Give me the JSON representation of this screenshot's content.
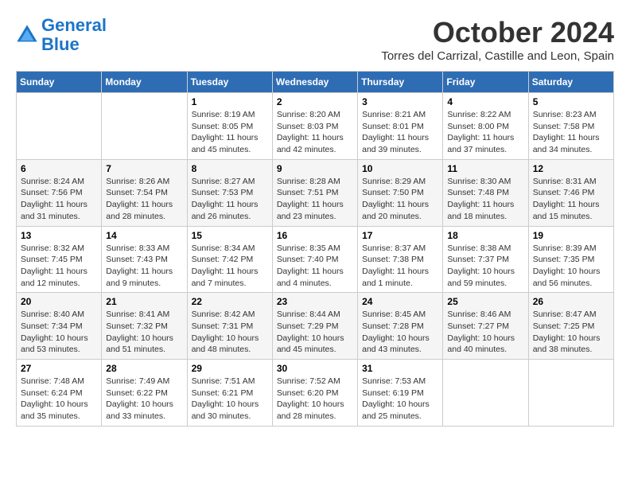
{
  "header": {
    "logo_line1": "General",
    "logo_line2": "Blue",
    "month": "October 2024",
    "location": "Torres del Carrizal, Castille and Leon, Spain"
  },
  "weekdays": [
    "Sunday",
    "Monday",
    "Tuesday",
    "Wednesday",
    "Thursday",
    "Friday",
    "Saturday"
  ],
  "weeks": [
    [
      {
        "day": "",
        "info": ""
      },
      {
        "day": "",
        "info": ""
      },
      {
        "day": "1",
        "info": "Sunrise: 8:19 AM\nSunset: 8:05 PM\nDaylight: 11 hours and 45 minutes."
      },
      {
        "day": "2",
        "info": "Sunrise: 8:20 AM\nSunset: 8:03 PM\nDaylight: 11 hours and 42 minutes."
      },
      {
        "day": "3",
        "info": "Sunrise: 8:21 AM\nSunset: 8:01 PM\nDaylight: 11 hours and 39 minutes."
      },
      {
        "day": "4",
        "info": "Sunrise: 8:22 AM\nSunset: 8:00 PM\nDaylight: 11 hours and 37 minutes."
      },
      {
        "day": "5",
        "info": "Sunrise: 8:23 AM\nSunset: 7:58 PM\nDaylight: 11 hours and 34 minutes."
      }
    ],
    [
      {
        "day": "6",
        "info": "Sunrise: 8:24 AM\nSunset: 7:56 PM\nDaylight: 11 hours and 31 minutes."
      },
      {
        "day": "7",
        "info": "Sunrise: 8:26 AM\nSunset: 7:54 PM\nDaylight: 11 hours and 28 minutes."
      },
      {
        "day": "8",
        "info": "Sunrise: 8:27 AM\nSunset: 7:53 PM\nDaylight: 11 hours and 26 minutes."
      },
      {
        "day": "9",
        "info": "Sunrise: 8:28 AM\nSunset: 7:51 PM\nDaylight: 11 hours and 23 minutes."
      },
      {
        "day": "10",
        "info": "Sunrise: 8:29 AM\nSunset: 7:50 PM\nDaylight: 11 hours and 20 minutes."
      },
      {
        "day": "11",
        "info": "Sunrise: 8:30 AM\nSunset: 7:48 PM\nDaylight: 11 hours and 18 minutes."
      },
      {
        "day": "12",
        "info": "Sunrise: 8:31 AM\nSunset: 7:46 PM\nDaylight: 11 hours and 15 minutes."
      }
    ],
    [
      {
        "day": "13",
        "info": "Sunrise: 8:32 AM\nSunset: 7:45 PM\nDaylight: 11 hours and 12 minutes."
      },
      {
        "day": "14",
        "info": "Sunrise: 8:33 AM\nSunset: 7:43 PM\nDaylight: 11 hours and 9 minutes."
      },
      {
        "day": "15",
        "info": "Sunrise: 8:34 AM\nSunset: 7:42 PM\nDaylight: 11 hours and 7 minutes."
      },
      {
        "day": "16",
        "info": "Sunrise: 8:35 AM\nSunset: 7:40 PM\nDaylight: 11 hours and 4 minutes."
      },
      {
        "day": "17",
        "info": "Sunrise: 8:37 AM\nSunset: 7:38 PM\nDaylight: 11 hours and 1 minute."
      },
      {
        "day": "18",
        "info": "Sunrise: 8:38 AM\nSunset: 7:37 PM\nDaylight: 10 hours and 59 minutes."
      },
      {
        "day": "19",
        "info": "Sunrise: 8:39 AM\nSunset: 7:35 PM\nDaylight: 10 hours and 56 minutes."
      }
    ],
    [
      {
        "day": "20",
        "info": "Sunrise: 8:40 AM\nSunset: 7:34 PM\nDaylight: 10 hours and 53 minutes."
      },
      {
        "day": "21",
        "info": "Sunrise: 8:41 AM\nSunset: 7:32 PM\nDaylight: 10 hours and 51 minutes."
      },
      {
        "day": "22",
        "info": "Sunrise: 8:42 AM\nSunset: 7:31 PM\nDaylight: 10 hours and 48 minutes."
      },
      {
        "day": "23",
        "info": "Sunrise: 8:44 AM\nSunset: 7:29 PM\nDaylight: 10 hours and 45 minutes."
      },
      {
        "day": "24",
        "info": "Sunrise: 8:45 AM\nSunset: 7:28 PM\nDaylight: 10 hours and 43 minutes."
      },
      {
        "day": "25",
        "info": "Sunrise: 8:46 AM\nSunset: 7:27 PM\nDaylight: 10 hours and 40 minutes."
      },
      {
        "day": "26",
        "info": "Sunrise: 8:47 AM\nSunset: 7:25 PM\nDaylight: 10 hours and 38 minutes."
      }
    ],
    [
      {
        "day": "27",
        "info": "Sunrise: 7:48 AM\nSunset: 6:24 PM\nDaylight: 10 hours and 35 minutes."
      },
      {
        "day": "28",
        "info": "Sunrise: 7:49 AM\nSunset: 6:22 PM\nDaylight: 10 hours and 33 minutes."
      },
      {
        "day": "29",
        "info": "Sunrise: 7:51 AM\nSunset: 6:21 PM\nDaylight: 10 hours and 30 minutes."
      },
      {
        "day": "30",
        "info": "Sunrise: 7:52 AM\nSunset: 6:20 PM\nDaylight: 10 hours and 28 minutes."
      },
      {
        "day": "31",
        "info": "Sunrise: 7:53 AM\nSunset: 6:19 PM\nDaylight: 10 hours and 25 minutes."
      },
      {
        "day": "",
        "info": ""
      },
      {
        "day": "",
        "info": ""
      }
    ]
  ]
}
